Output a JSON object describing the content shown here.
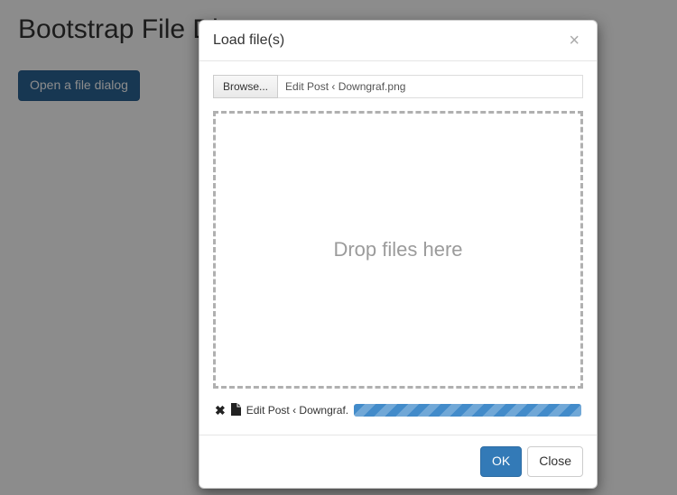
{
  "page": {
    "title": "Bootstrap File Dia"
  },
  "trigger": {
    "label": "Open a file dialog"
  },
  "modal": {
    "title": "Load file(s)",
    "browse_label": "Browse...",
    "selected_file": "Edit Post ‹ Downgraf.png",
    "dropzone_text": "Drop files here",
    "queue": {
      "filename": "Edit Post ‹ Downgraf."
    },
    "buttons": {
      "ok": "OK",
      "close": "Close"
    }
  }
}
